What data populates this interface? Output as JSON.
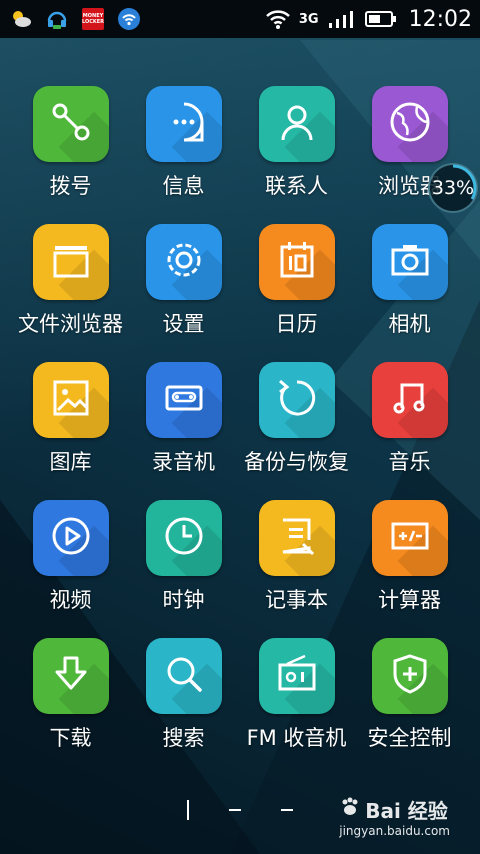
{
  "status_bar": {
    "time": "12:02",
    "network": "3G",
    "notification_icons": [
      "weather-icon",
      "headset-icon",
      "money-locker-icon",
      "wifi-notification-icon"
    ],
    "money_locker_text": "MONEY LOCKER"
  },
  "memory_badge": {
    "text": "33%"
  },
  "apps": [
    {
      "label": "拨号",
      "color": "#4fb83a",
      "icon": "phone-icon"
    },
    {
      "label": "信息",
      "color": "#2a95e8",
      "icon": "message-icon"
    },
    {
      "label": "联系人",
      "color": "#25b8a5",
      "icon": "contacts-icon"
    },
    {
      "label": "浏览器",
      "color": "#9a58d2",
      "icon": "browser-icon"
    },
    {
      "label": "文件浏览器",
      "color": "#f4b91f",
      "icon": "folder-icon"
    },
    {
      "label": "设置",
      "color": "#2a95e8",
      "icon": "settings-icon"
    },
    {
      "label": "日历",
      "color": "#f58a1e",
      "icon": "calendar-icon"
    },
    {
      "label": "相机",
      "color": "#2a95e8",
      "icon": "camera-icon"
    },
    {
      "label": "图库",
      "color": "#f4b91f",
      "icon": "gallery-icon"
    },
    {
      "label": "录音机",
      "color": "#2f78e0",
      "icon": "recorder-icon"
    },
    {
      "label": "备份与恢复",
      "color": "#2ab6c8",
      "icon": "backup-icon"
    },
    {
      "label": "音乐",
      "color": "#e8403c",
      "icon": "music-icon"
    },
    {
      "label": "视频",
      "color": "#2f78e0",
      "icon": "video-icon"
    },
    {
      "label": "时钟",
      "color": "#22b59c",
      "icon": "clock-icon"
    },
    {
      "label": "记事本",
      "color": "#f4b91f",
      "icon": "notepad-icon"
    },
    {
      "label": "计算器",
      "color": "#f58a1e",
      "icon": "calculator-icon"
    },
    {
      "label": "下载",
      "color": "#4fb83a",
      "icon": "download-icon"
    },
    {
      "label": "搜索",
      "color": "#2ab6c8",
      "icon": "search-icon"
    },
    {
      "label": "FM 收音机",
      "color": "#25b8a5",
      "icon": "radio-icon"
    },
    {
      "label": "安全控制",
      "color": "#4fb83a",
      "icon": "shield-icon"
    }
  ],
  "pager": {
    "pages": 3,
    "active": 0
  },
  "watermark": {
    "brand": "Bai 经验",
    "url": "jingyan.baidu.com"
  }
}
